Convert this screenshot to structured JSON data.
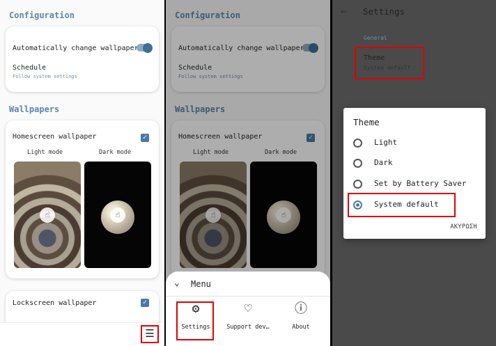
{
  "screen1": {
    "config_title": "Configuration",
    "auto_change_label": "Automatically change wallpaper",
    "schedule_label": "Schedule",
    "schedule_sub": "Follow system settings",
    "wallpapers_title": "Wallpapers",
    "homescreen_label": "Homescreen wallpaper",
    "light_mode_label": "Light mode",
    "dark_mode_label": "Dark mode",
    "lockscreen_label": "Lockscreen wallpaper",
    "menu_icon": "hamburger-menu-icon"
  },
  "screen2": {
    "menu_title": "Menu",
    "items": [
      {
        "label": "Settings",
        "icon": "gear-icon"
      },
      {
        "label": "Support dev…",
        "icon": "heart-hand-icon"
      },
      {
        "label": "About",
        "icon": "info-icon"
      }
    ]
  },
  "screen3": {
    "title": "Settings",
    "general_label": "General",
    "theme_label": "Theme",
    "theme_value": "System default",
    "dialog": {
      "title": "Theme",
      "options": [
        "Light",
        "Dark",
        "Set by Battery Saver",
        "System default"
      ],
      "selected": "System default",
      "cancel": "ΑΚΥΡΩΣΗ"
    }
  },
  "colors": {
    "accent": "#4a79a6",
    "highlight": "#e00000",
    "section": "#5b86ad"
  }
}
